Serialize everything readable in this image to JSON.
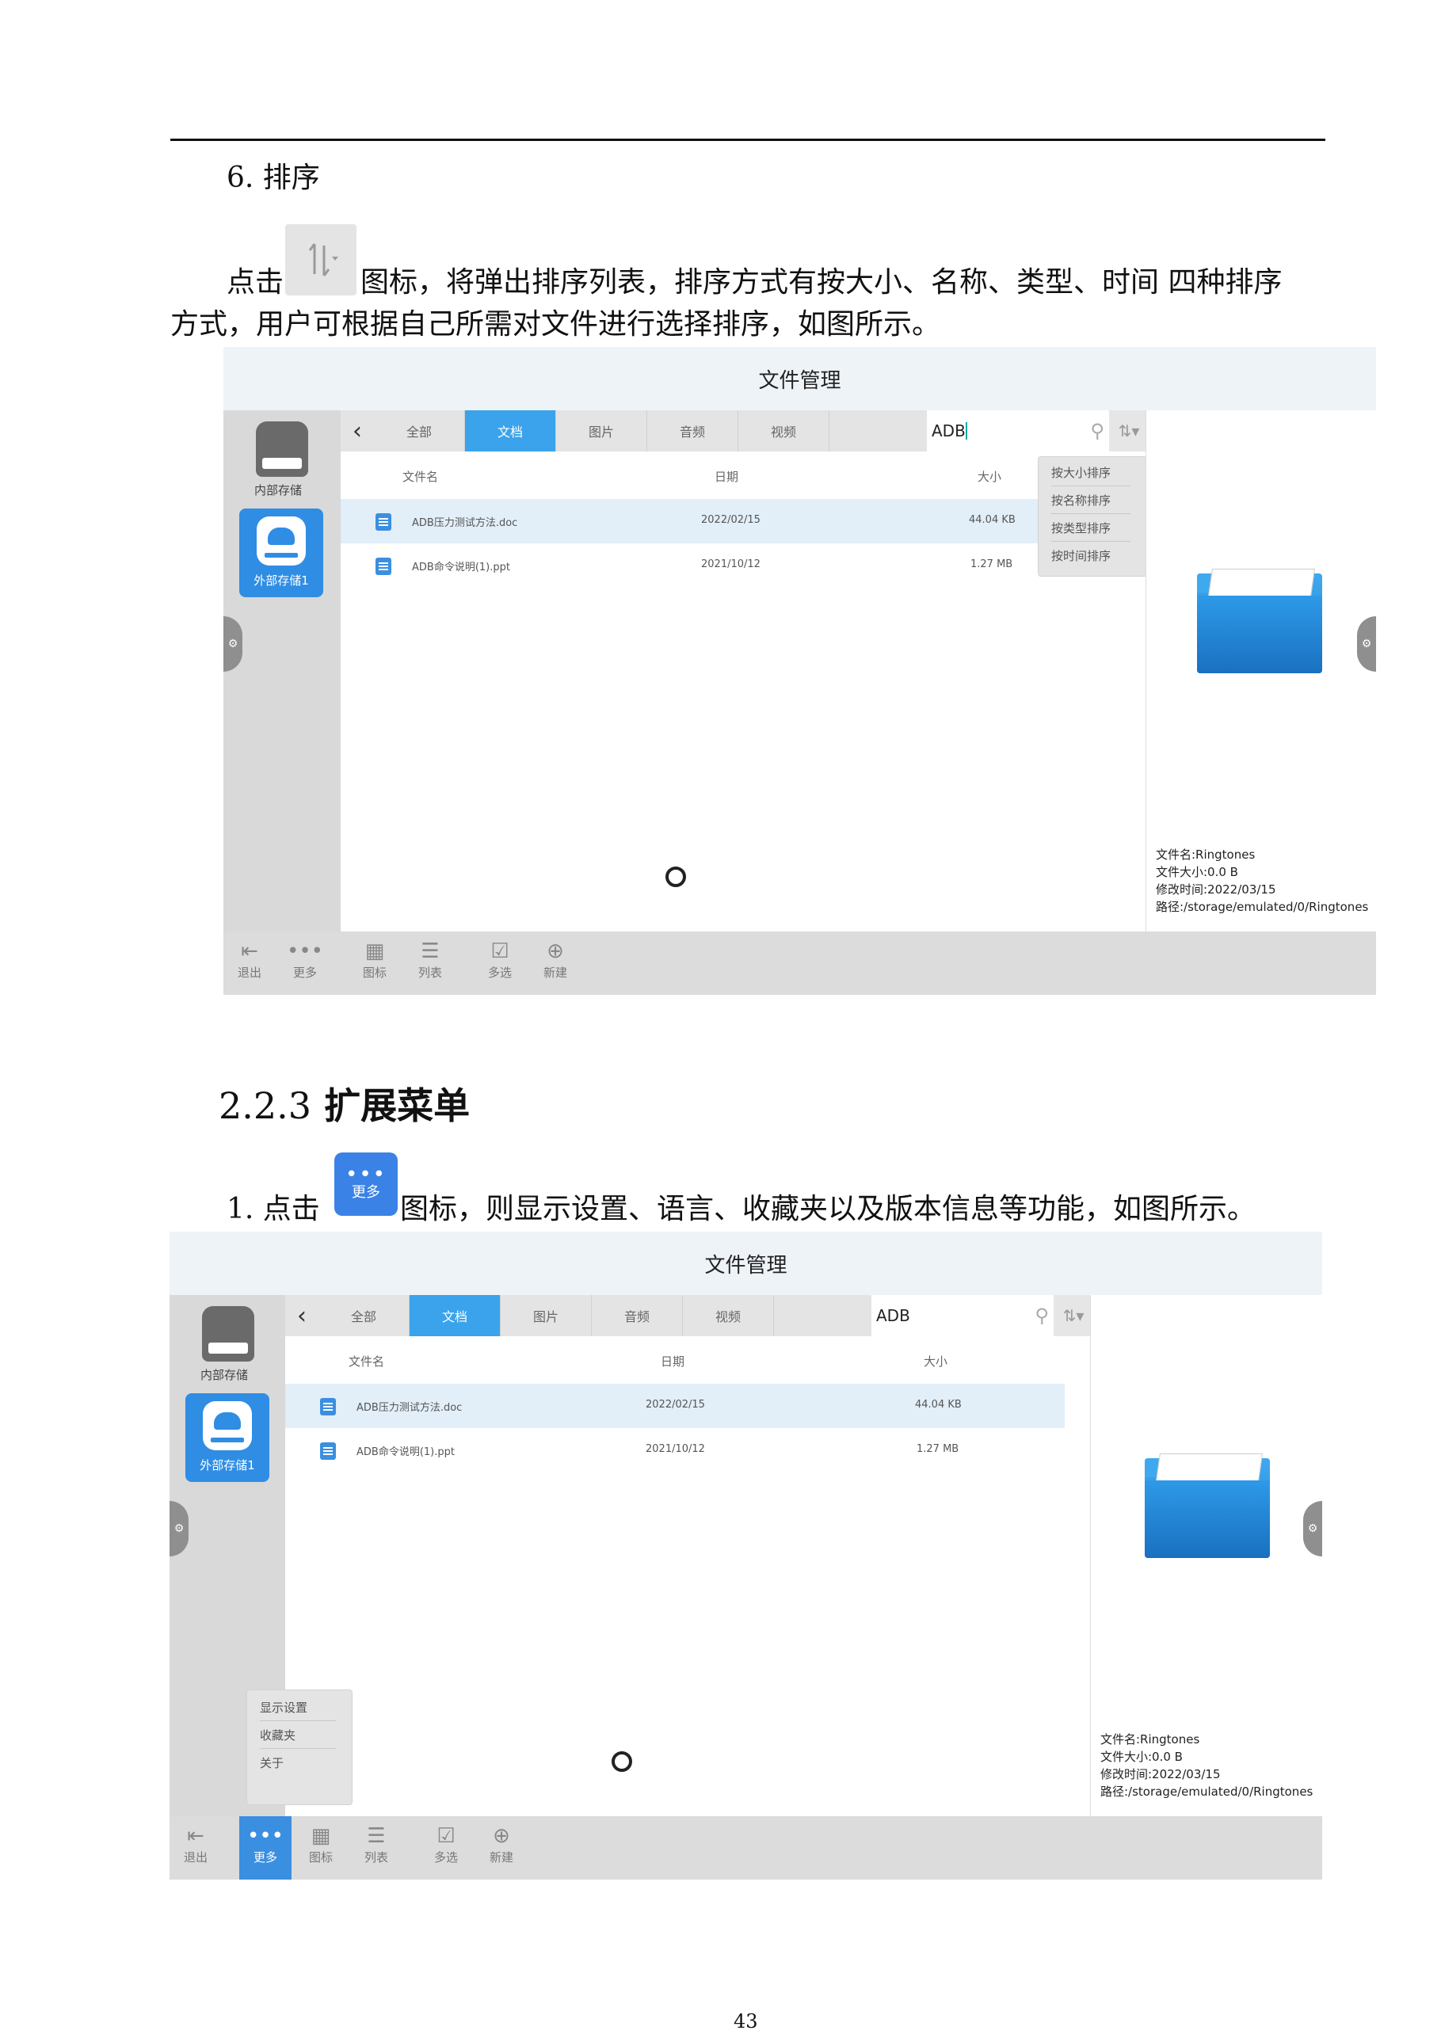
{
  "section6": {
    "heading": "6. 排序",
    "line1_before": "点击",
    "line1_after": "图标，将弹出排序列表，排序方式有按大小、名称、类型、时间 四种排序",
    "line2": "方式，用户可根据自己所需对文件进行选择排序，如图所示。"
  },
  "section223": {
    "heading_num": "2.2.3",
    "heading_text": "扩展菜单",
    "line1_before": "1. 点击",
    "line1_after": "图标，则显示设置、语言、收藏夹以及版本信息等功能，如图所示。",
    "more_icon_label": "更多"
  },
  "app": {
    "title": "文件管理",
    "internal_storage": "内部存储",
    "external_storage": "外部存储1",
    "tabs": [
      "全部",
      "文档",
      "图片",
      "音频",
      "视频"
    ],
    "active_tab": "文档",
    "search_value": "ADB",
    "columns": {
      "name": "文件名",
      "date": "日期",
      "size": "大小"
    },
    "files": [
      {
        "name": "ADB压力测试方法.doc",
        "date": "2022/02/15",
        "size": "44.04 KB"
      },
      {
        "name": "ADB命令说明(1).ppt",
        "date": "2021/10/12",
        "size": "1.27 MB"
      }
    ],
    "info": {
      "name": "文件名:Ringtones",
      "size": "文件大小:0.0 B",
      "mtime": "修改时间:2022/03/15",
      "path": "路径:/storage/emulated/0/Ringtones"
    },
    "toolbar": [
      "退出",
      "更多",
      "图标",
      "列表",
      "多选",
      "新建"
    ],
    "sort_menu": [
      "按大小排序",
      "按名称排序",
      "按类型排序",
      "按时间排序"
    ],
    "more_menu": [
      "显示设置",
      "收藏夹",
      "关于"
    ]
  },
  "page_number": "43"
}
